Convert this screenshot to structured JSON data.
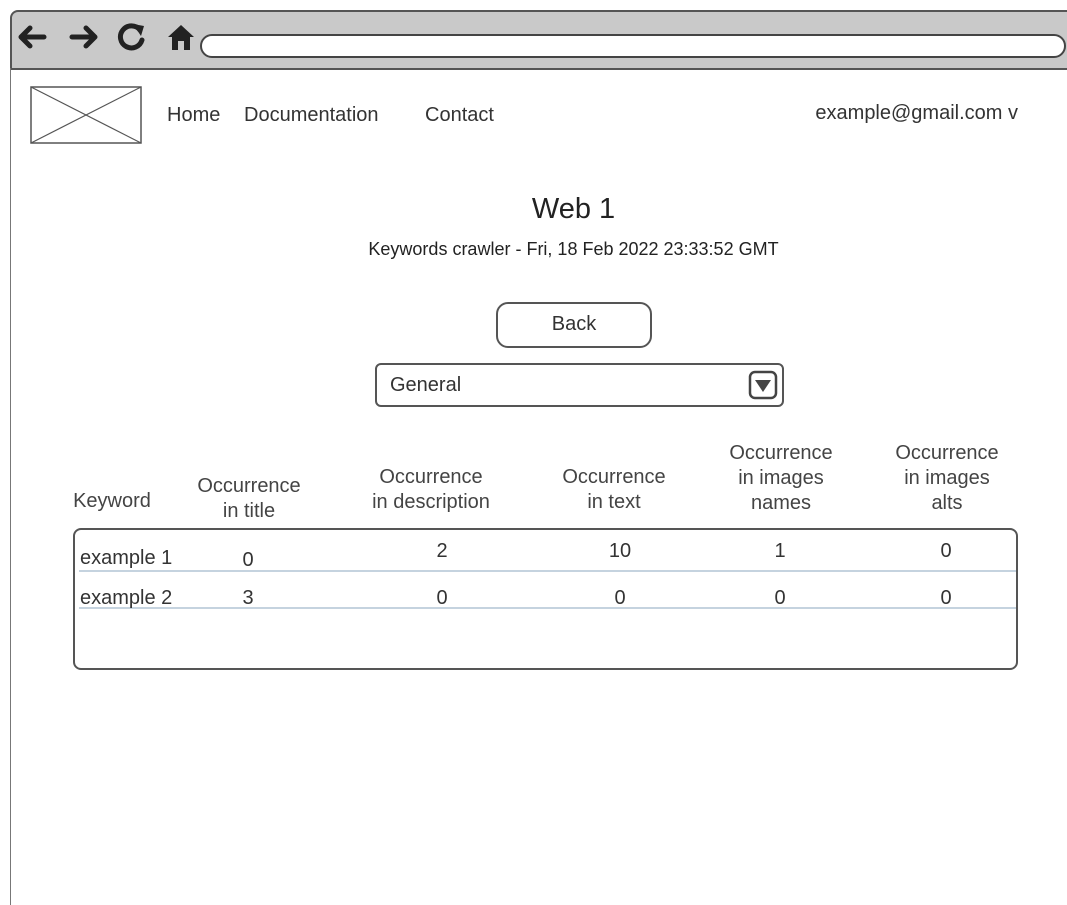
{
  "browser": {
    "icons": [
      "back-arrow-icon",
      "forward-arrow-icon",
      "reload-icon",
      "home-icon"
    ],
    "url": ""
  },
  "header": {
    "logo": "image-placeholder",
    "nav": [
      "Home",
      "Documentation",
      "Contact"
    ],
    "user": "example@gmail.com v"
  },
  "page": {
    "title": "Web 1",
    "subtitle": "Keywords crawler - Fri, 18 Feb 2022 23:33:52 GMT",
    "back_label": "Back",
    "select_value": "General"
  },
  "table": {
    "columns": [
      "Keyword",
      "Occurrence\nin title",
      "Occurrence\nin description",
      "Occurrence\nin text",
      "Occurrence\nin images\nnames",
      "Occurrence\nin images\nalts"
    ],
    "rows": [
      [
        "example 1",
        "0",
        "2",
        "10",
        "1",
        "0"
      ],
      [
        "example 2",
        "3",
        "0",
        "0",
        "0",
        "0"
      ]
    ]
  },
  "colors": {
    "chrome": "#c9c9c9",
    "border": "#555555",
    "row_line": "#c5d3df"
  }
}
